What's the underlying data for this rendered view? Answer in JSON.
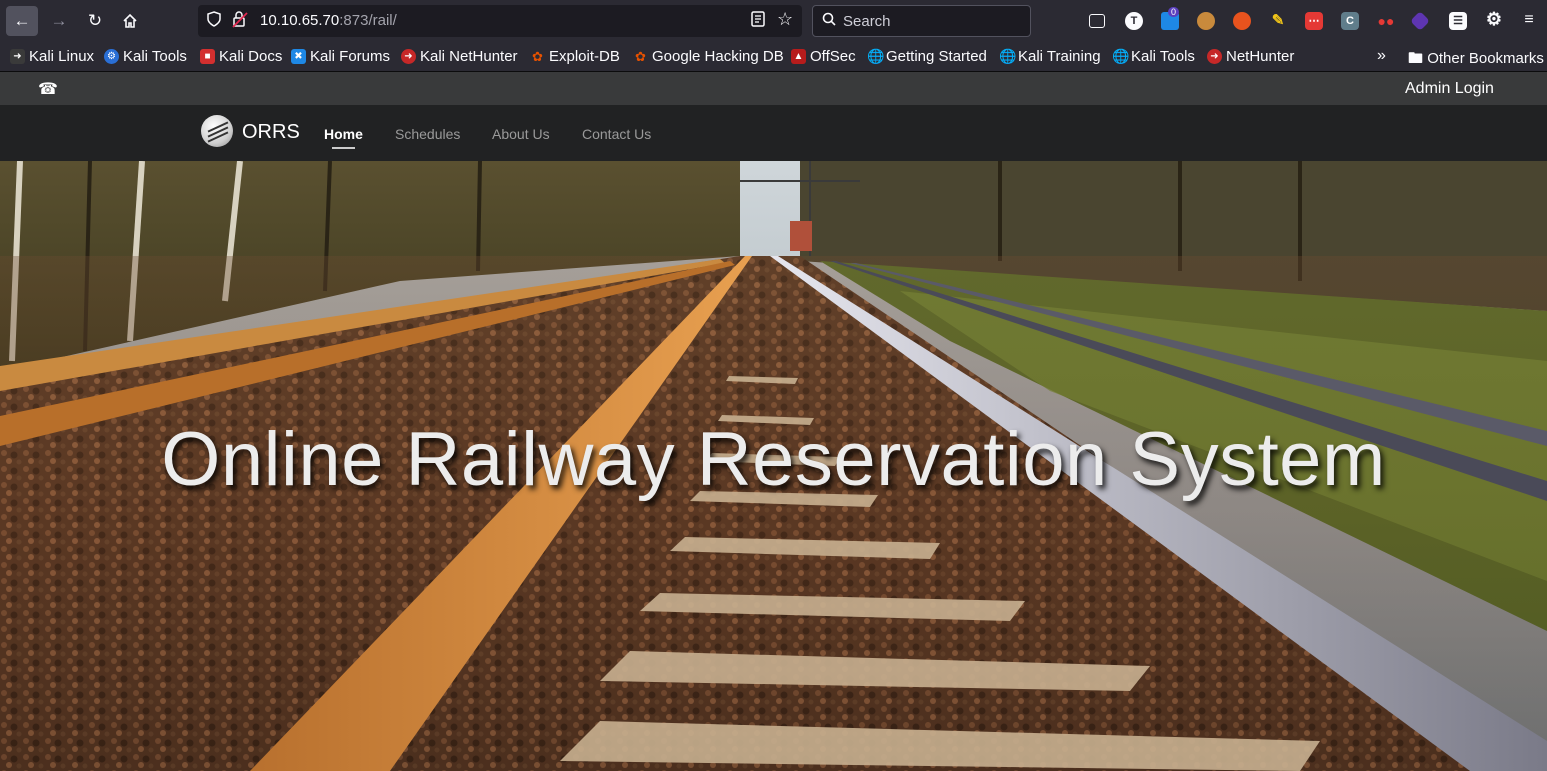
{
  "browser": {
    "url_host": "10.10.65.70",
    "url_path": ":873/rail/",
    "search_placeholder": "Search",
    "extension_badge": "0"
  },
  "bookmarks": {
    "items": [
      {
        "label": "Kali Linux",
        "icon": "kali-dragon-icon",
        "color": "#3a3a3a"
      },
      {
        "label": "Kali Tools",
        "icon": "kali-tools-icon",
        "color": "#2a6fd6"
      },
      {
        "label": "Kali Docs",
        "icon": "kali-docs-icon",
        "color": "#d32f2f"
      },
      {
        "label": "Kali Forums",
        "icon": "kali-forums-icon",
        "color": "#1e88e5"
      },
      {
        "label": "Kali NetHunter",
        "icon": "nethunter-icon",
        "color": "#c62828"
      },
      {
        "label": "Exploit-DB",
        "icon": "exploit-db-icon",
        "color": "#e65100"
      },
      {
        "label": "Google Hacking DB",
        "icon": "ghdb-icon",
        "color": "#e65100"
      },
      {
        "label": "OffSec",
        "icon": "offsec-icon",
        "color": "#b71c1c"
      },
      {
        "label": "Getting Started",
        "icon": "globe-icon",
        "color": "transparent"
      },
      {
        "label": "Kali Training",
        "icon": "globe-icon",
        "color": "transparent"
      },
      {
        "label": "Kali Tools",
        "icon": "globe-icon",
        "color": "transparent"
      },
      {
        "label": "NetHunter",
        "icon": "nethunter-icon",
        "color": "#c62828"
      }
    ],
    "other_label": "Other Bookmarks"
  },
  "site": {
    "admin_login": "Admin Login",
    "brand": "ORRS",
    "nav": {
      "home": "Home",
      "schedules": "Schedules",
      "about": "About Us",
      "contact": "Contact Us"
    },
    "hero_title": "Online Railway Reservation System"
  }
}
